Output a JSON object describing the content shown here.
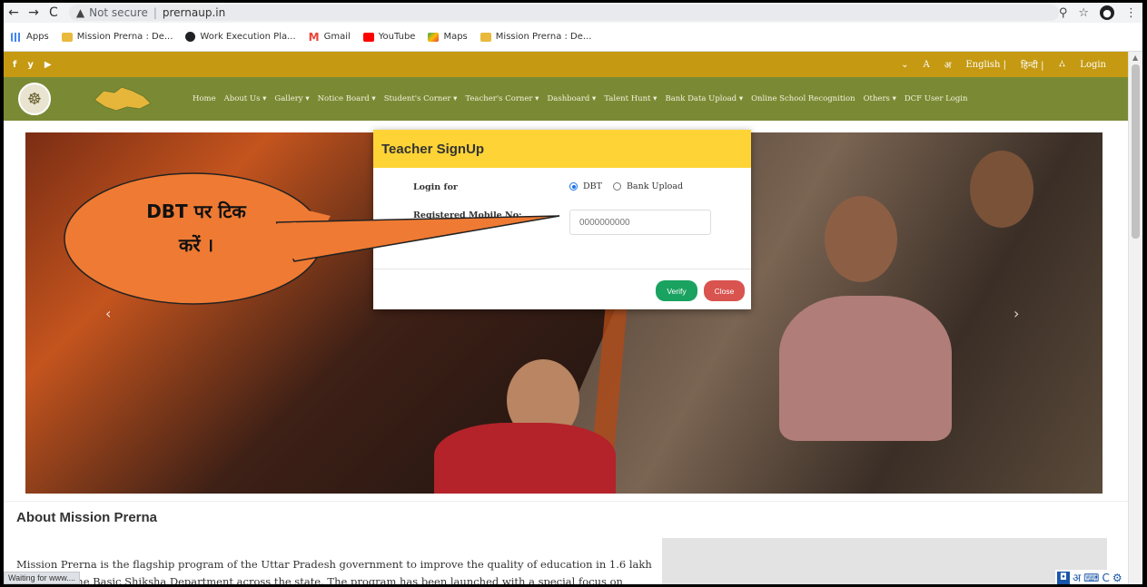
{
  "browser": {
    "security_label": "Not secure",
    "url": "prernaup.in",
    "bookmarks": [
      {
        "label": "Apps",
        "color": "#4285f4"
      },
      {
        "label": "Mission Prerna : De...",
        "color": "#e8b93b"
      },
      {
        "label": "Work Execution Pla...",
        "color": "#202124"
      },
      {
        "label": "Gmail",
        "color": "#ea4335"
      },
      {
        "label": "YouTube",
        "color": "#ff0000"
      },
      {
        "label": "Maps",
        "color": "#34a853"
      },
      {
        "label": "Mission Prerna : De...",
        "color": "#e8b93b"
      }
    ],
    "status": "Waiting for www...."
  },
  "site": {
    "social": [
      "f",
      "y",
      "▶"
    ],
    "top_right": [
      "A",
      "अ",
      "English |",
      "हिन्दी |",
      "Login"
    ],
    "menu": [
      "Home",
      "About Us ▾",
      "Gallery ▾",
      "Notice Board ▾",
      "Student's Corner ▾",
      "Teacher's Corner ▾",
      "Dashboard ▾",
      "Talent Hunt ▾",
      "Bank Data Upload ▾",
      "Online School Recognition",
      "Others ▾",
      "DCF User Login"
    ],
    "brand_color": "#7a8a34",
    "strip_color": "#c59a12"
  },
  "modal": {
    "title": "Teacher SignUp",
    "login_for_label": "Login for",
    "option_dbt": "DBT",
    "option_bank": "Bank Upload",
    "mobile_label": "Registered Mobile No:",
    "mobile_placeholder": "0000000000",
    "verify_label": "Verify",
    "close_label": "Close"
  },
  "callout": {
    "line1": "DBT पर टिक",
    "line2": "करें ।"
  },
  "about": {
    "title": "About Mission Prerna",
    "text": "Mission Prerna is the flagship program of the Uttar Pradesh government to improve the quality of education in 1.6 lakh schools of the Basic Shiksha Department across the state. The program has been launched with a special focus on"
  },
  "ime": {
    "hindi": "अ",
    "c": "C"
  }
}
